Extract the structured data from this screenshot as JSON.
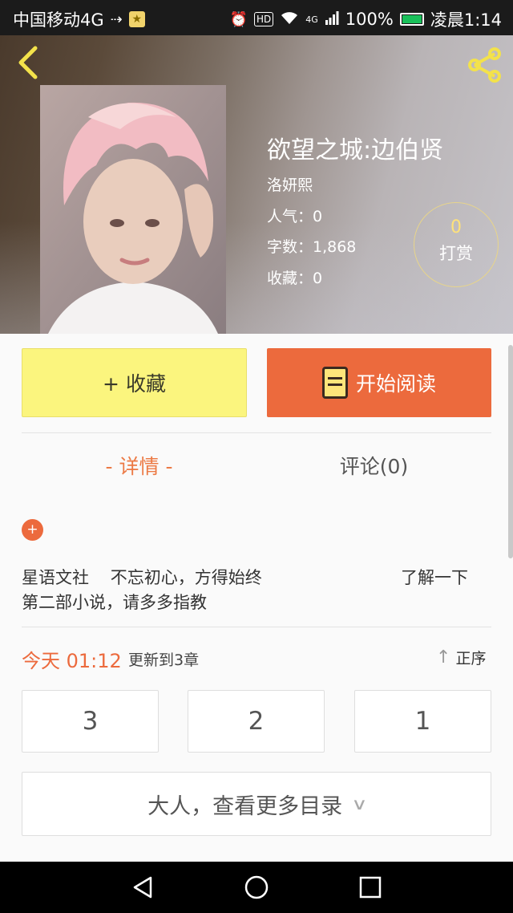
{
  "status_bar": {
    "carrier": "中国移动4G",
    "hd": "HD",
    "network": "4G",
    "battery": "100%",
    "time": "凌晨1:14"
  },
  "book": {
    "title": "欲望之城:边伯贤",
    "author": "洛妍熙",
    "popularity": "人气：0",
    "word_count": "字数：1,868",
    "favorites": "收藏：0"
  },
  "reward": {
    "count": "0",
    "label": "打赏"
  },
  "actions": {
    "collect_label": "+ 收藏",
    "read_label": "开始阅读"
  },
  "tabs": [
    {
      "label": "- 详情 -",
      "active": true
    },
    {
      "label": "评论(0)",
      "active": false
    }
  ],
  "description": {
    "line1": "星语文社    不忘初心，方得始终",
    "line2": "第二部小说，请多多指教",
    "learn_more": "了解一下"
  },
  "update": {
    "time": "今天 01:12",
    "text": "更新到3章",
    "sort_label": "正序"
  },
  "chapters": [
    "3",
    "2",
    "1"
  ],
  "more_toc_label": "大人，查看更多目录",
  "colors": {
    "accent": "#ec6a3d",
    "collect_bg": "#fbf57e",
    "back_icon": "#f3e24b"
  }
}
